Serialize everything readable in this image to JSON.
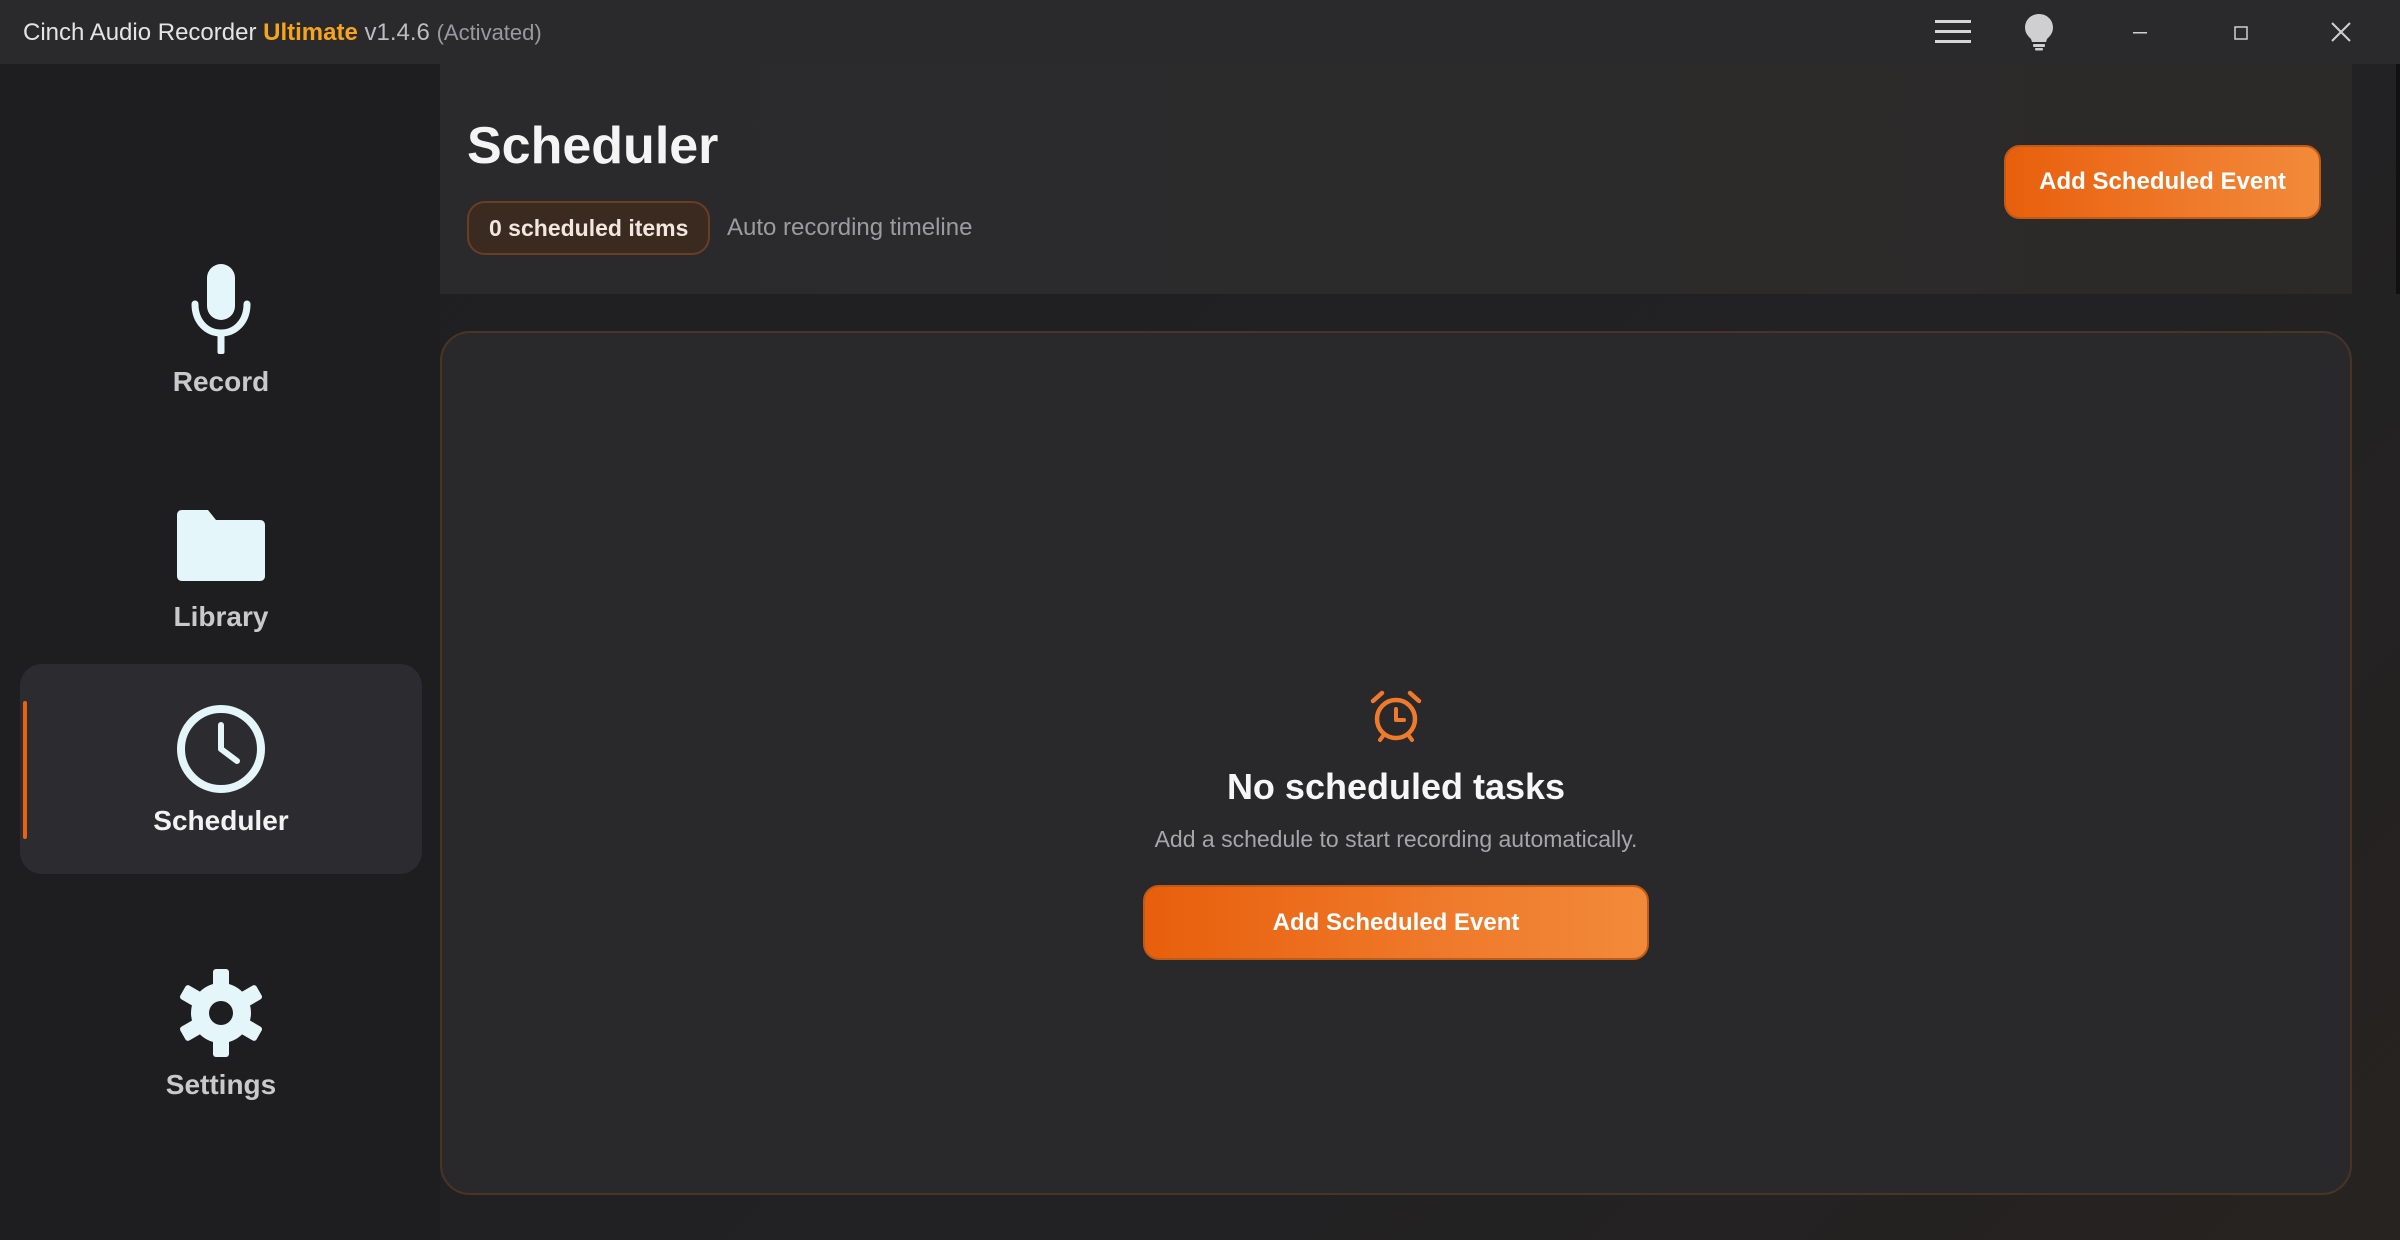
{
  "window": {
    "app_name": "Cinch Audio Recorder",
    "edition": "Ultimate",
    "version": "v1.4.6",
    "status": "(Activated)",
    "accent_color": "#e8620f",
    "edition_color": "#f6a31d"
  },
  "titlebar_icons": [
    "menu-icon",
    "lightbulb-icon",
    "minimize-icon",
    "maximize-icon",
    "close-icon"
  ],
  "sidebar": {
    "items": [
      {
        "label": "Record",
        "icon": "microphone-icon",
        "active": false
      },
      {
        "label": "Library",
        "icon": "folder-icon",
        "active": false
      },
      {
        "label": "Scheduler",
        "icon": "clock-icon",
        "active": true
      },
      {
        "label": "Settings",
        "icon": "gear-icon",
        "active": false
      }
    ]
  },
  "header": {
    "title": "Scheduler",
    "count_badge": "0 scheduled items",
    "subtitle": "Auto recording timeline",
    "add_button": "Add Scheduled Event"
  },
  "empty_state": {
    "icon": "alarm-clock-icon",
    "title": "No scheduled tasks",
    "description": "Add a schedule to start recording automatically.",
    "button": "Add Scheduled Event"
  }
}
